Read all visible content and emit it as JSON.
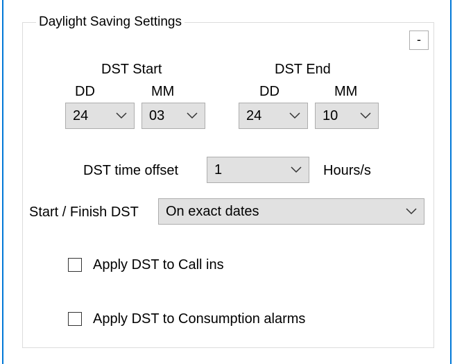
{
  "group": {
    "title": "Daylight Saving Settings",
    "collapse_label": "-"
  },
  "dst_start": {
    "title": "DST Start",
    "dd_label": "DD",
    "mm_label": "MM",
    "dd_value": "24",
    "mm_value": "03"
  },
  "dst_end": {
    "title": "DST End",
    "dd_label": "DD",
    "mm_label": "MM",
    "dd_value": "24",
    "mm_value": "10"
  },
  "offset": {
    "label": "DST time offset",
    "value": "1",
    "unit": "Hours/s"
  },
  "start_finish": {
    "label": "Start / Finish DST",
    "value": "On exact dates"
  },
  "options": [
    {
      "label": "Apply DST to Call ins",
      "checked": false
    },
    {
      "label": "Apply DST to Consumption alarms",
      "checked": false
    }
  ],
  "icons": {
    "dropdown": "chevron-down-icon"
  },
  "colors": {
    "accent_border": "#0078d7",
    "combo_background": "#e1e1e1"
  }
}
